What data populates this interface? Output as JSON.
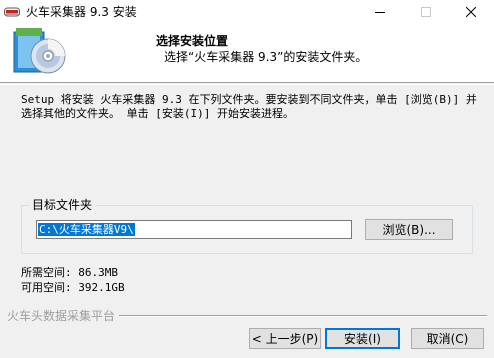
{
  "window": {
    "title": "火车采集器 9.3 安装"
  },
  "header": {
    "title": "选择安装位置",
    "subtitle": "选择“火车采集器 9.3”的安装文件夹。"
  },
  "main": {
    "description": "Setup 将安装 火车采集器 9.3 在下列文件夹。要安装到不同文件夹，单击 [浏览(B)] 并选择其他的文件夹。 单击 [安装(I)] 开始安装进程。",
    "folder_group_label": "目标文件夹",
    "folder_path": "C:\\火车采集器V9\\",
    "browse_label": "浏览(B)...",
    "space_required": "所需空间: 86.3MB",
    "space_available": "可用空间: 392.1GB"
  },
  "footer": {
    "brand": "火车头数据采集平台",
    "back_label": "< 上一步(P)",
    "install_label": "安装(I)",
    "cancel_label": "取消(C)"
  },
  "colors": {
    "selection": "#0078d7",
    "dialog_bg": "#f0f0f0",
    "header_bg": "#ffffff"
  },
  "icons": [
    "app-icon",
    "minimize-icon",
    "maximize-icon",
    "close-icon",
    "installer-cd-icon"
  ]
}
